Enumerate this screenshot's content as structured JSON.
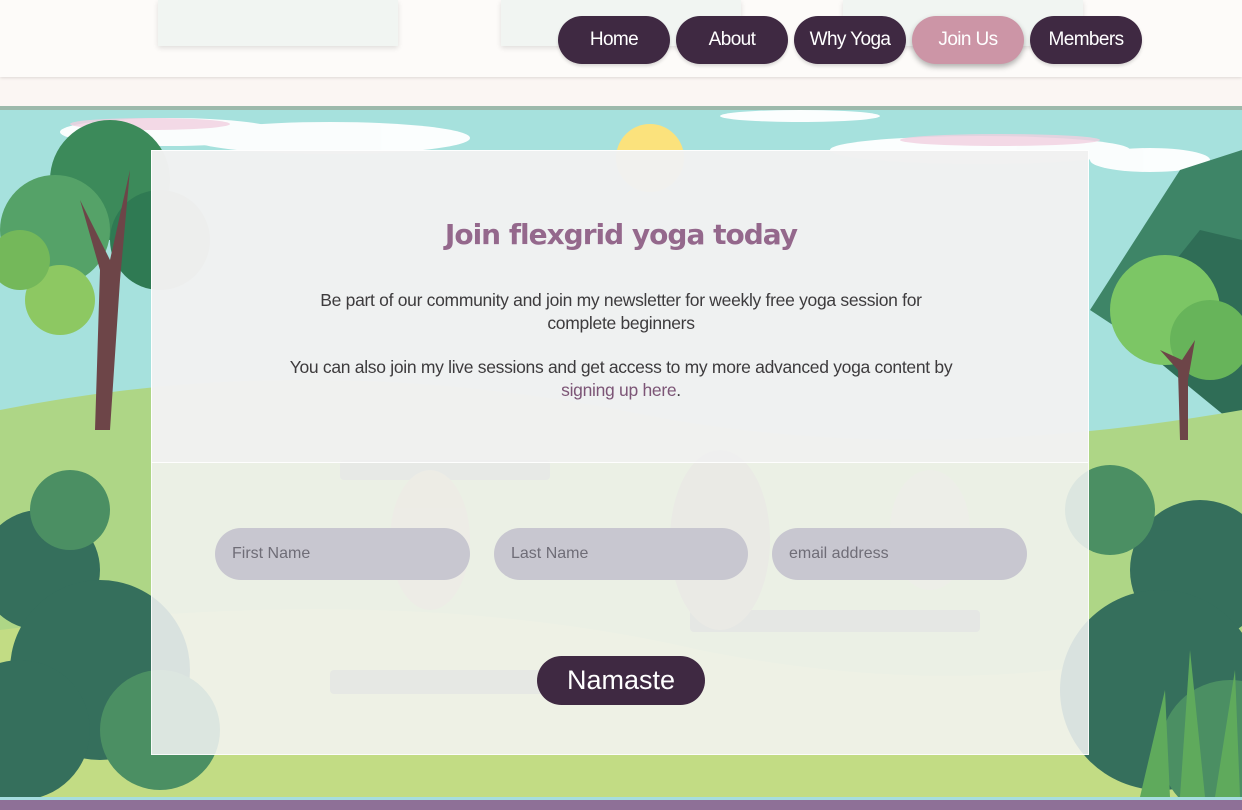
{
  "nav": {
    "items": [
      {
        "label": "Home",
        "active": false
      },
      {
        "label": "About",
        "active": false
      },
      {
        "label": "Why Yoga",
        "active": false
      },
      {
        "label": "Join Us",
        "active": true
      },
      {
        "label": "Members",
        "active": false
      }
    ]
  },
  "join": {
    "title": "Join flexgrid yoga today",
    "paragraph1_line1": "Be part of our community and join my newsletter for weekly free yoga session for",
    "paragraph1_line2": "complete beginners",
    "paragraph2_line1": "You can also join my live sessions and get access to my more advanced yoga content by",
    "link_text": "signing up here",
    "paragraph2_suffix": "."
  },
  "form": {
    "first_name_placeholder": "First Name",
    "last_name_placeholder": "Last Name",
    "email_placeholder": "email address",
    "submit_label": "Namaste"
  },
  "colors": {
    "nav_button": "#3f2942",
    "nav_active": "#cc95a6",
    "title": "#94688c",
    "input_bg": "#c8c7d0"
  }
}
